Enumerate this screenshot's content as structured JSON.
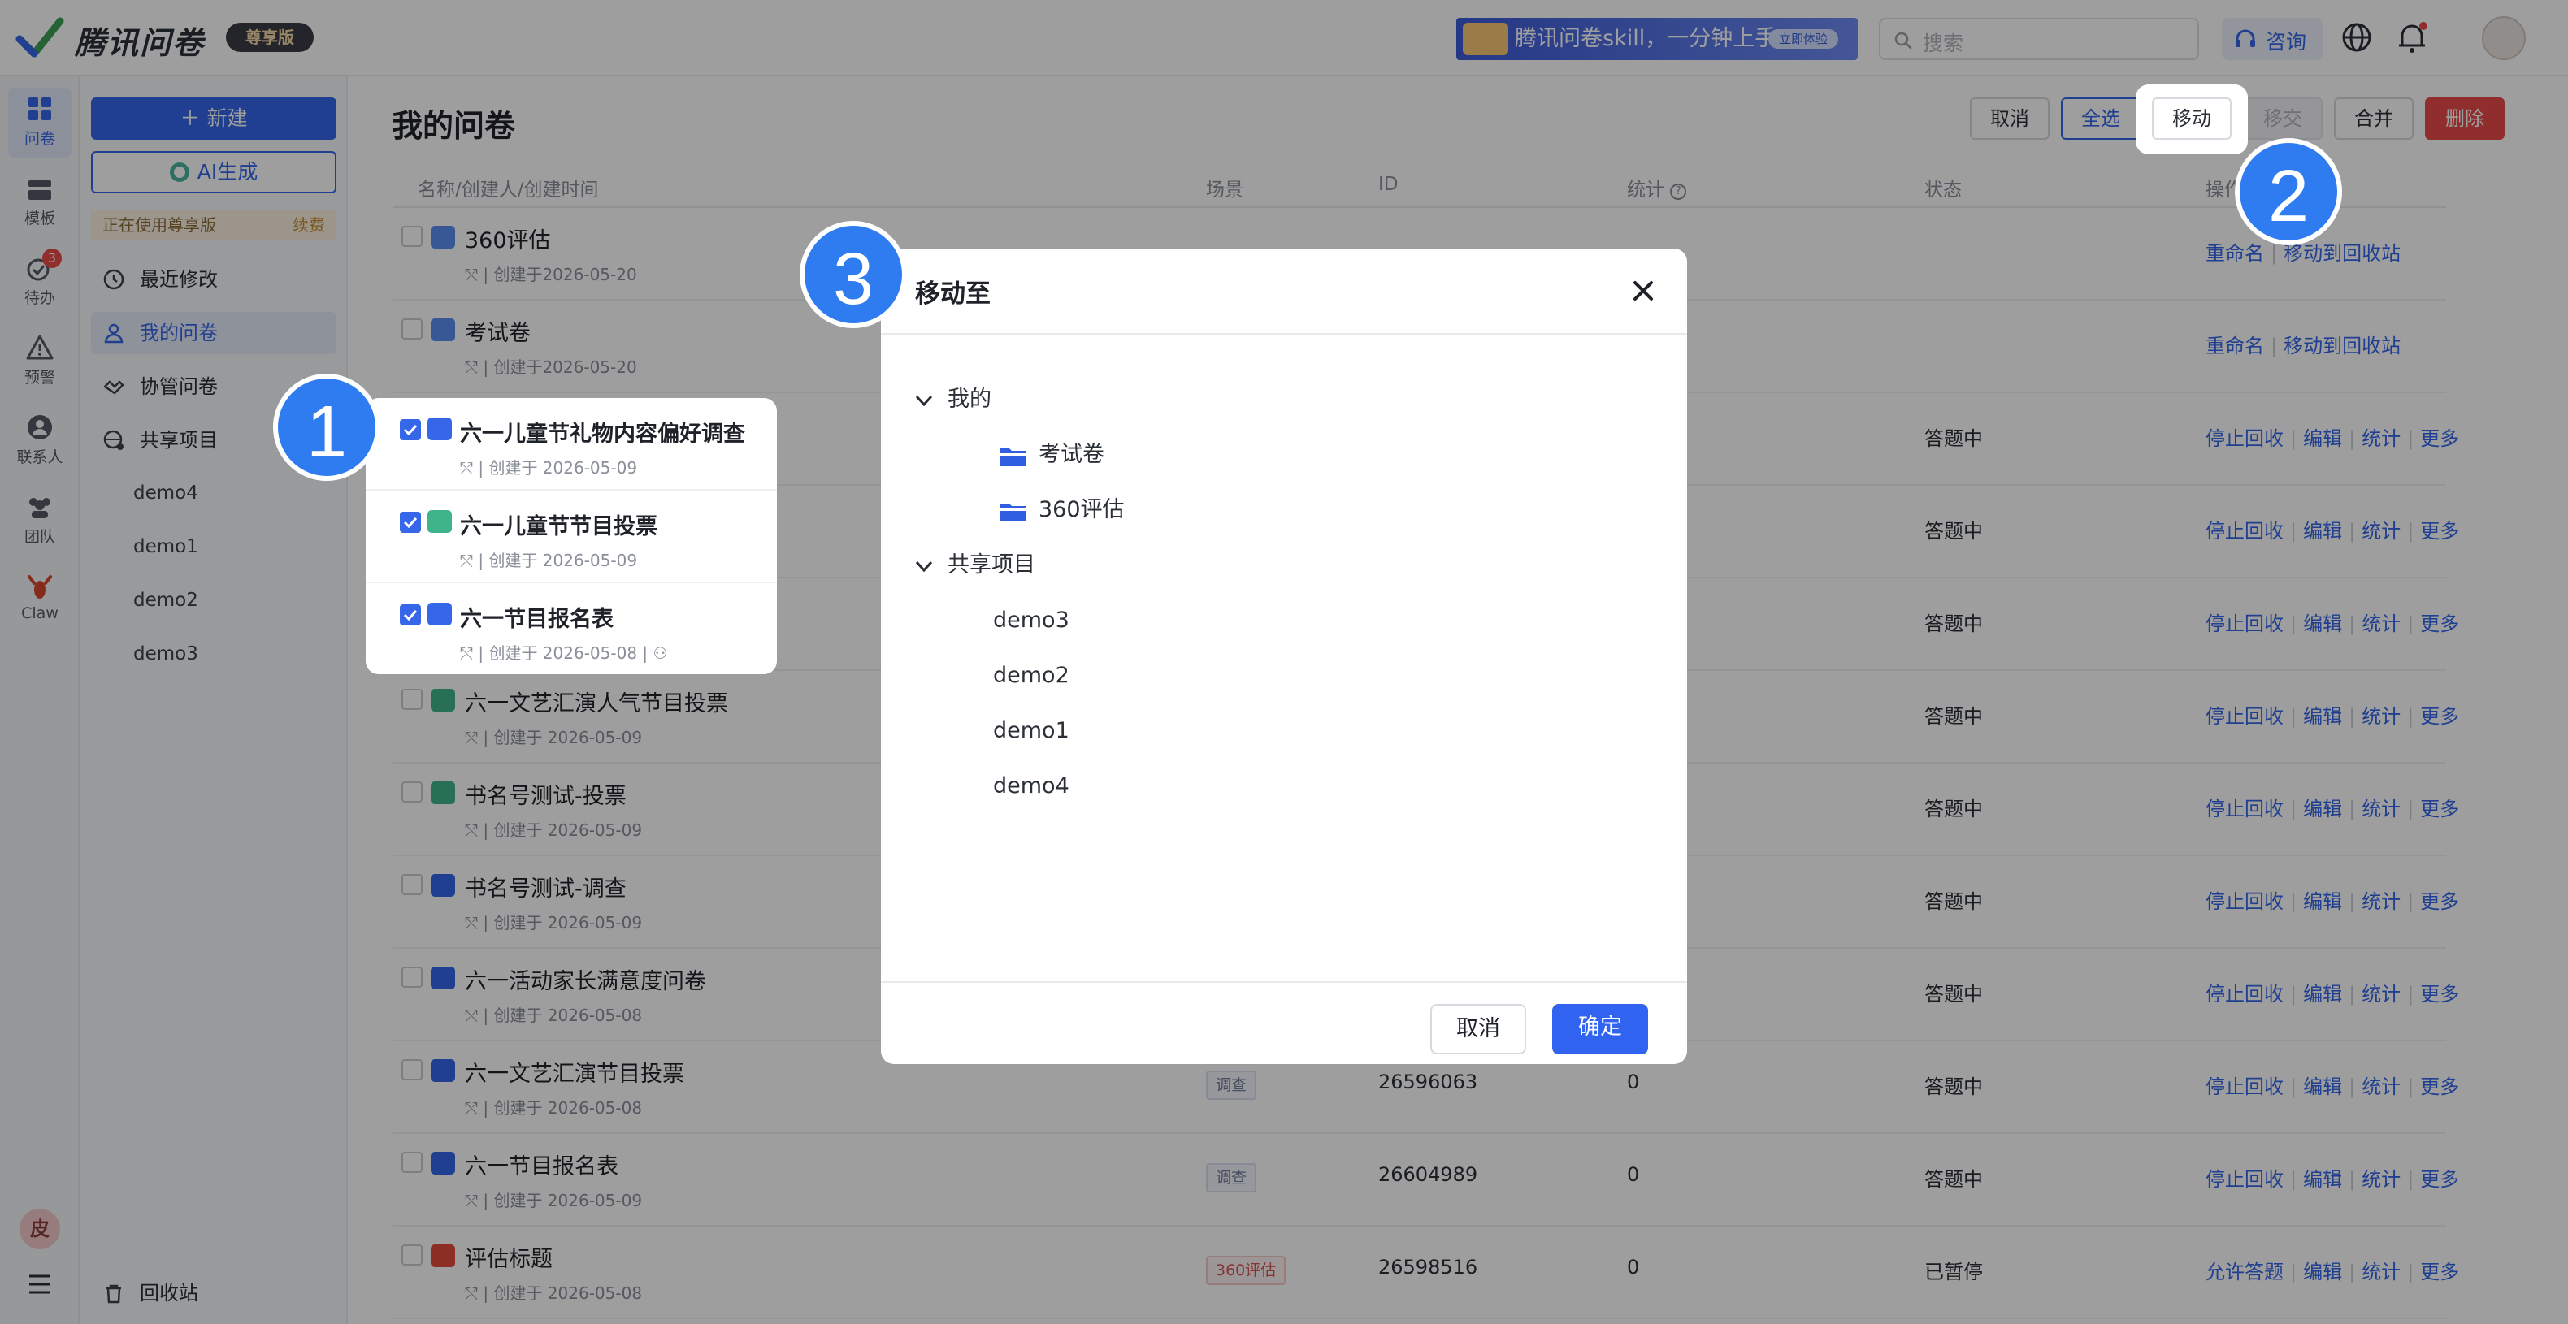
{
  "brand": {
    "name": "腾讯问卷",
    "badge": "尊享版"
  },
  "topbar": {
    "banner_text": "腾讯问卷skill，一分钟上手",
    "banner_tag": "立即体验",
    "search_placeholder": "搜索",
    "consult_label": "咨询"
  },
  "rail": [
    {
      "label": "问卷"
    },
    {
      "label": "模板"
    },
    {
      "label": "待办",
      "badge": "3"
    },
    {
      "label": "预警"
    },
    {
      "label": "联系人"
    },
    {
      "label": "团队"
    },
    {
      "label": "Claw"
    }
  ],
  "rail_avatar": "皮",
  "sidebar": {
    "new_label": "新建",
    "ai_label": "AI生成",
    "plan_text": "正在使用尊享版",
    "plan_renew": "续费",
    "nav": [
      {
        "label": "最近修改"
      },
      {
        "label": "我的问卷"
      },
      {
        "label": "协管问卷"
      },
      {
        "label": "共享项目"
      }
    ],
    "projects": [
      "demo4",
      "demo1",
      "demo2",
      "demo3"
    ],
    "recycle_label": "回收站"
  },
  "main": {
    "title": "我的问卷",
    "toolbar": {
      "cancel": "取消",
      "select_all": "全选",
      "move": "移动",
      "transfer": "移交",
      "merge": "合并",
      "delete": "删除"
    },
    "columns": {
      "name": "名称/创建人/创建时间",
      "scene": "场景",
      "id": "ID",
      "stats": "统计",
      "status": "状态",
      "actions": "操作"
    },
    "rows": [
      {
        "name": "360评估",
        "meta": "| 创建于2026-05-20",
        "kind": "folder",
        "actions": [
          "重命名",
          "移动到回收站"
        ]
      },
      {
        "name": "考试卷",
        "meta": "| 创建于2026-05-20",
        "kind": "folder",
        "actions": [
          "重命名",
          "移动到回收站"
        ]
      },
      {
        "name": "六一儿童节礼物内容偏好调查",
        "meta": "| 创建于 2026-05-09",
        "kind": "survey",
        "checked": true,
        "status": "答题中",
        "actions": [
          "停止回收",
          "编辑",
          "统计",
          "更多"
        ]
      },
      {
        "name": "六一儿童节节目投票",
        "meta": "| 创建于 2026-05-09",
        "kind": "vote",
        "checked": true,
        "status": "答题中",
        "actions": [
          "停止回收",
          "编辑",
          "统计",
          "更多"
        ]
      },
      {
        "name": "六一节目报名表",
        "meta": "| 创建于 2026-05-08 |",
        "kind": "survey",
        "checked": true,
        "status": "答题中",
        "actions": [
          "停止回收",
          "编辑",
          "统计",
          "更多"
        ]
      },
      {
        "name": "六一文艺汇演人气节目投票",
        "meta": "| 创建于 2026-05-09",
        "kind": "vote",
        "status": "答题中",
        "actions": [
          "停止回收",
          "编辑",
          "统计",
          "更多"
        ]
      },
      {
        "name": "书名号测试-投票",
        "meta": "| 创建于 2026-05-09",
        "kind": "vote",
        "status": "答题中",
        "actions": [
          "停止回收",
          "编辑",
          "统计",
          "更多"
        ]
      },
      {
        "name": "书名号测试-调查",
        "meta": "| 创建于 2026-05-09",
        "kind": "survey",
        "status": "答题中",
        "actions": [
          "停止回收",
          "编辑",
          "统计",
          "更多"
        ]
      },
      {
        "name": "六一活动家长满意度问卷",
        "meta": "| 创建于 2026-05-08",
        "kind": "survey",
        "status": "答题中",
        "actions": [
          "停止回收",
          "编辑",
          "统计",
          "更多"
        ]
      },
      {
        "name": "六一文艺汇演节目投票",
        "meta": "| 创建于 2026-05-08",
        "kind": "survey",
        "scene": "调查",
        "id": "26596063",
        "stat": "0",
        "status": "答题中",
        "actions": [
          "停止回收",
          "编辑",
          "统计",
          "更多"
        ]
      },
      {
        "name": "六一节目报名表",
        "meta": "| 创建于 2026-05-09",
        "kind": "survey",
        "scene": "调查",
        "id": "26604989",
        "stat": "0",
        "status": "答题中",
        "actions": [
          "停止回收",
          "编辑",
          "统计",
          "更多"
        ]
      },
      {
        "name": "评估标题",
        "meta": "| 创建于 2026-05-08",
        "kind": "eval",
        "scene": "360评估",
        "id": "26598516",
        "stat": "0",
        "status": "已暂停",
        "actions": [
          "允许答题",
          "编辑",
          "统计",
          "更多"
        ]
      }
    ]
  },
  "dialog": {
    "title": "移动至",
    "groups": [
      {
        "label": "我的",
        "children": [
          "考试卷",
          "360评估"
        ]
      },
      {
        "label": "共享项目",
        "children": [
          "demo3",
          "demo2",
          "demo1",
          "demo4"
        ]
      }
    ],
    "cancel": "取消",
    "confirm": "确定"
  },
  "callouts": [
    "1",
    "2",
    "3"
  ],
  "colors": {
    "accent": "#3567e8",
    "danger": "#e84a4a",
    "callout": "#2f7cf0"
  }
}
